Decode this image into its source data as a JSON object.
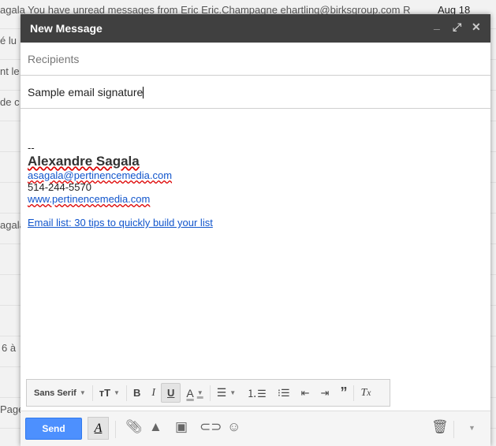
{
  "inbox_bg": {
    "rows": [
      {
        "text": "agala You have unread messages from Eric Eric.Champagne ehartling@birksgroup.com R",
        "date": "Aug 18"
      },
      {
        "text": "é lu",
        "date": ""
      },
      {
        "text": "nt le",
        "date": ""
      },
      {
        "text": "de c",
        "date": ""
      },
      {
        "text": "",
        "date": ""
      },
      {
        "text": "",
        "date": ""
      },
      {
        "text": "",
        "date": ""
      },
      {
        "text": "agala",
        "date": ""
      },
      {
        "text": "",
        "date": ""
      },
      {
        "text": "",
        "date": ""
      },
      {
        "text": "",
        "date": ""
      },
      {
        "text": "6 à",
        "date": ""
      },
      {
        "text": "",
        "date": ""
      },
      {
        "text": "Page",
        "date": ""
      }
    ]
  },
  "compose": {
    "title": "New Message",
    "recipients_placeholder": "Recipients",
    "subject": "Sample email signature",
    "body": {
      "dashes": "--",
      "name": "Alexandre Sagala",
      "email": "asagala@pertinencemedia.com",
      "phone": "514-244-5570",
      "website": "www.pertinencemedia.com",
      "link": "Email list: 30 tips to quickly build your list"
    },
    "format_toolbar": {
      "font": "Sans Serif"
    },
    "send_label": "Send"
  },
  "colors": {
    "header": "#404040",
    "send": "#4d90fe",
    "link": "#1155cc"
  }
}
